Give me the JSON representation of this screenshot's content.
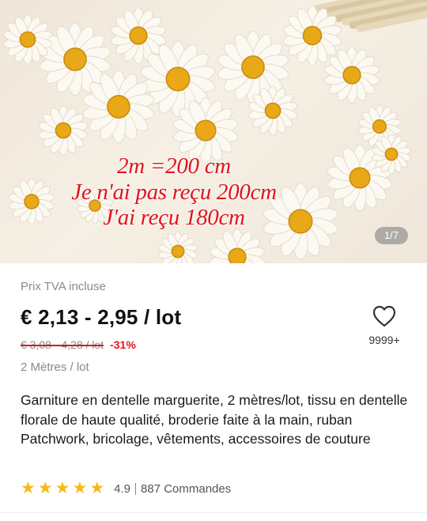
{
  "gallery": {
    "overlay_lines": [
      "2m =200 cm",
      "Je n'ai pas reçu 200cm",
      "J'ai reçu 180cm"
    ],
    "counter": "1/7"
  },
  "pricing": {
    "tax_note": "Prix TVA incluse",
    "price_range": "€ 2,13 - 2,95 / lot",
    "original_price": "€ 3,08 - 4,28 / lot",
    "discount": "-31%",
    "unit": "2 Mètres / lot",
    "accent_color": "#e0141c"
  },
  "wishlist": {
    "icon": "heart-outline-icon",
    "count": "9999+"
  },
  "product": {
    "title": "Garniture en dentelle marguerite, 2 mètres/lot, tissu en dentelle florale de haute qualité, broderie faite à la main, ruban Patchwork, bricolage, vêtements, accessoires de couture"
  },
  "rating": {
    "stars": 5,
    "score": "4.9",
    "orders": "887 Commandes",
    "star_color": "#f6b81b"
  }
}
